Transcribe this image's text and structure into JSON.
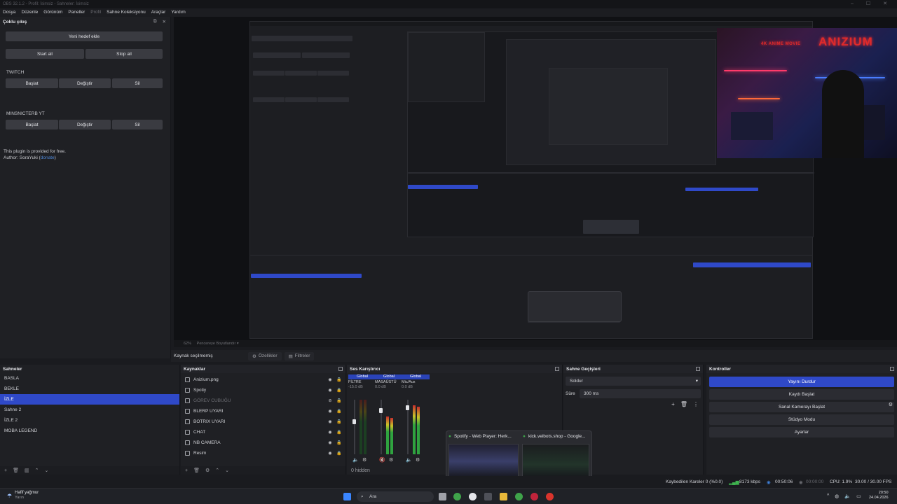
{
  "titlebar": {
    "title": "OBS 32.1.2 - Profil: İsimsiz - Sahneler: İsimsiz"
  },
  "menu": [
    {
      "label": "Dosya",
      "dim": false
    },
    {
      "label": "Düzenle",
      "dim": false
    },
    {
      "label": "Görünüm",
      "dim": false
    },
    {
      "label": "Paneller",
      "dim": false
    },
    {
      "label": "Profil",
      "dim": true
    },
    {
      "label": "Sahne Koleksiyonu",
      "dim": false
    },
    {
      "label": "Araçlar",
      "dim": false
    },
    {
      "label": "Yardım",
      "dim": false
    }
  ],
  "multi_output": {
    "title": "Çoklu çıkış",
    "add_target": "Yeni hedef ekle",
    "start_all": "Start all",
    "stop_all": "Stop all",
    "targets": [
      {
        "name": "TWITCH",
        "start": "Başlat",
        "edit": "Değiştir",
        "delete": "Sil"
      },
      {
        "name": "MINSNICTERB YT",
        "start": "Başlat",
        "edit": "Değiştir",
        "delete": "Sil"
      }
    ],
    "info_line1": "This plugin is provided for free.",
    "info_author": "Author: SoraYuki (",
    "info_link": "donate",
    "info_close": ")"
  },
  "webcam": {
    "logo_small": "4K ANIME MOVIE",
    "logo": "ANIZIUM"
  },
  "zoombar": {
    "zoom": "62%",
    "mode": "Pencereye Boyutlandır"
  },
  "source_toolbar": {
    "no_selection": "Kaynak seçilmemiş",
    "properties": "Özellikler",
    "filters": "Filtreler"
  },
  "scenes": {
    "title": "Sahneler",
    "items": [
      {
        "label": "BASLA",
        "selected": false
      },
      {
        "label": "BEKLE",
        "selected": false
      },
      {
        "label": "İZLE",
        "selected": true
      },
      {
        "label": "Sahne 2",
        "selected": false
      },
      {
        "label": "İZLE 2",
        "selected": false
      },
      {
        "label": "MOBA LEGEND",
        "selected": false
      }
    ]
  },
  "sources": {
    "title": "Kaynaklar",
    "items": [
      {
        "label": "Anizium.png",
        "dim": false
      },
      {
        "label": "Spotiy",
        "dim": false
      },
      {
        "label": "GÖREV CUBUĞU",
        "dim": true
      },
      {
        "label": "BLERP UYARI",
        "dim": false
      },
      {
        "label": "BOTRIX UYARI",
        "dim": false
      },
      {
        "label": "CHAT",
        "dim": false
      },
      {
        "label": "NB CAMERA",
        "dim": false
      },
      {
        "label": "Resim",
        "dim": false
      }
    ]
  },
  "mixer": {
    "title": "Ses Karıştırıcı",
    "channels": [
      {
        "badge": "Global",
        "name": "FİLTRE",
        "db": "-15.0 dB"
      },
      {
        "badge": "Global",
        "name": "MASAÜSTÜ",
        "db": "0.0 dB"
      },
      {
        "badge": "Global",
        "name": "Mic/Aux",
        "db": "0.0 dB"
      }
    ],
    "hidden": "0 hidden"
  },
  "transitions": {
    "title": "Sahne Geçişleri",
    "selected": "Soldur",
    "duration_label": "Süre",
    "duration_value": "300 ms"
  },
  "controls": {
    "title": "Kontroller",
    "buttons": [
      {
        "label": "Yayını Durdur",
        "active": true
      },
      {
        "label": "Kaydı Başlat",
        "active": false
      },
      {
        "label": "Sanal Kamerayı Başlat",
        "active": false
      },
      {
        "label": "Stüdyo Modu",
        "active": false
      },
      {
        "label": "Ayarlar",
        "active": false
      }
    ]
  },
  "status": {
    "dropped": "Kaybedilen Kareler 0 (%0.0)",
    "bitrate": "8173 kbps",
    "stream_time": "00:50:06",
    "rec_time": "00:00:00",
    "cpu": "CPU: 1.9%",
    "fps": "30.00 / 30.00 FPS"
  },
  "taskbar": {
    "weather_title": "Hafif yağmur",
    "weather_sub": "Yarın",
    "search": "Ara",
    "time": "20:50",
    "date": "24.04.2026"
  },
  "popup": {
    "left_title": "Spotify - Web Player: Herk...",
    "right_title": "kick.veibots.shop - Google..."
  }
}
